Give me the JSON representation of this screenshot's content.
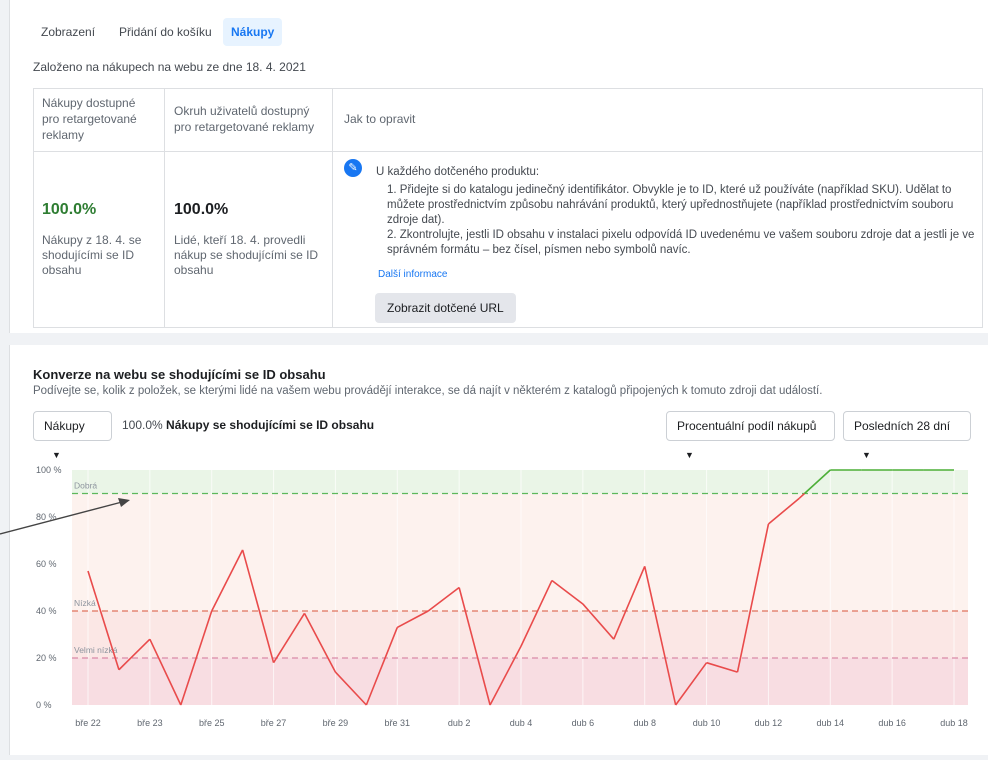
{
  "tabs": [
    {
      "label": "Zobrazení"
    },
    {
      "label": "Přidání do košíku"
    },
    {
      "label": "Nákupy"
    }
  ],
  "based_on": "Založeno na nákupech na webu ze dne 18. 4. 2021",
  "table": {
    "col1_header": [
      "Nákupy dostupné",
      "pro retargetované",
      "reklamy"
    ],
    "col2_header": [
      "Okruh uživatelů dostupný",
      "pro retargetované reklamy"
    ],
    "col3_header": "Jak to opravit",
    "col1_value": "100.0%",
    "col1_desc": [
      "Nákupy z 18. 4. se",
      "shodujícími se ID",
      "obsahu"
    ],
    "col2_value": "100.0%",
    "col2_desc": [
      "Lidé, kteří 18. 4. provedli",
      "nákup se shodujícími se ID",
      "obsahu"
    ],
    "fix_title": "U každého dotčeného produktu:",
    "fix_lines": [
      "1. Přidejte si do katalogu jedinečný identifikátor. Obvykle je to ID, které už používáte (například SKU). Udělat to",
      "můžete prostřednictvím způsobu nahrávání produktů, který upřednostňujete (například prostřednictvím souboru",
      "zdroje dat).",
      "2. Zkontrolujte, jestli ID obsahu v instalaci pixelu odpovídá ID uvedenému ve vašem souboru zdroje dat a jestli je ve",
      "správném formátu – bez čísel, písmen nebo symbolů navíc."
    ],
    "more_info": "Další informace",
    "show_urls_button": "Zobrazit dotčené URL",
    "good_color": "#2e7d32"
  },
  "section": {
    "title": "Konverze na webu se shodujícími se ID obsahu",
    "subtitle": "Podívejte se, kolik z položek, se kterými lidé na vašem webu provádějí interakce, se dá najít v některém z katalogů připojených k tomuto zdroji dat událostí.",
    "event_dropdown": "Nákupy",
    "metric_value": "100.0%",
    "metric_label": "Nákupy se shodujícími se ID obsahu",
    "measure_dropdown": "Procentuální podíl nákupů",
    "range_dropdown": "Posledních 28 dní"
  },
  "chart_data": {
    "type": "line",
    "x_tick_labels": [
      "bře 22",
      "bře 23",
      "bře 25",
      "bře 27",
      "bře 29",
      "bře 31",
      "dub 2",
      "dub 4",
      "dub 6",
      "dub 8",
      "dub 10",
      "dub 12",
      "dub 14",
      "dub 16",
      "dub 18"
    ],
    "y_tick_labels": [
      "100 %",
      "80 %",
      "60 %",
      "40 %",
      "20 %",
      "0 %"
    ],
    "ylim": [
      0,
      100
    ],
    "series": [
      {
        "values": [
          57,
          15,
          28,
          0,
          40,
          66,
          18,
          39,
          14,
          0,
          33,
          40,
          50,
          0,
          25,
          53,
          43,
          28,
          59,
          0,
          18,
          14,
          77,
          88,
          100,
          100,
          100,
          100,
          100
        ]
      }
    ],
    "thresholds": [
      {
        "label": "Dobrá",
        "value": 90,
        "color": "#5cb85c"
      },
      {
        "label": "Nízká",
        "value": 40,
        "color": "#e0735e"
      },
      {
        "label": "Velmi nízká",
        "value": 20,
        "color": "#d98aa8"
      }
    ],
    "line_color_low": "#e94b4b",
    "line_color_good": "#4caf37",
    "grid": true,
    "arrow_annotation": true
  }
}
